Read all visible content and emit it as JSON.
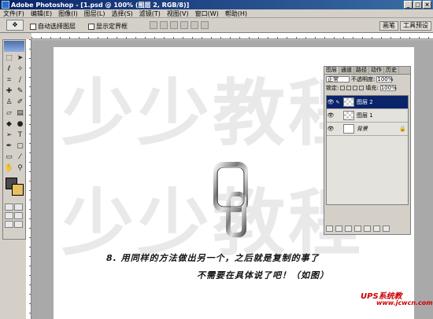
{
  "window": {
    "title": "Adobe Photoshop - [1.psd @ 100% (图层 2, RGB/8)]",
    "minimize": "_",
    "maximize": "□",
    "close": "×"
  },
  "menu": [
    "文件(F)",
    "编辑(E)",
    "图像(I)",
    "图层(L)",
    "选择(S)",
    "滤镜(T)",
    "视图(V)",
    "窗口(W)",
    "帮助(H)"
  ],
  "options": {
    "auto_select": "自动选择图层",
    "show_bounds": "显示定界框",
    "panel_tabs": [
      "画笔",
      "工具预设"
    ]
  },
  "layers_panel": {
    "tabs": [
      "图层",
      "通道",
      "路径",
      "动作",
      "历史"
    ],
    "blend_mode": "正常",
    "opacity_label": "不透明度:",
    "opacity_value": "100%",
    "lock_label": "锁定:",
    "fill_label": "填充:",
    "fill_value": "100%",
    "layers": [
      {
        "name": "图层 2",
        "selected": true
      },
      {
        "name": "图层 1",
        "selected": false
      },
      {
        "name": "背景",
        "selected": false
      }
    ]
  },
  "canvas": {
    "watermark": "少少教程",
    "caption_line1": "8. 用同样的方法做出另一个，之后就是复制的事了",
    "caption_line2": "不需要在具体说了吧！（如图）"
  },
  "site": {
    "name": "UPS系统教",
    "url": "www.jcwcn.com"
  }
}
